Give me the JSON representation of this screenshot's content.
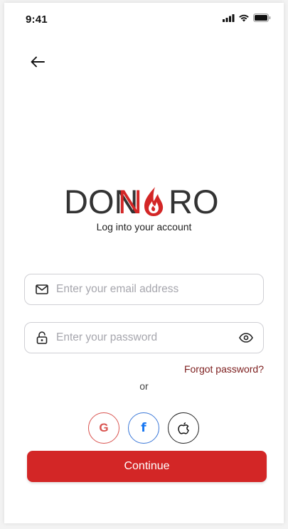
{
  "status_bar": {
    "time": "9:41"
  },
  "back": {
    "icon": "arrow-left-icon"
  },
  "brand": {
    "logo_text_left": "DON",
    "logo_text_red": "N",
    "logo_text_right": "RO",
    "colors": {
      "dark": "#333333",
      "red": "#d32626"
    }
  },
  "login": {
    "subtitle": "Log into your account",
    "email": {
      "value": "",
      "placeholder": "Enter your email address",
      "icon": "mail-icon"
    },
    "password": {
      "value": "",
      "placeholder": "Enter your password",
      "icon": "lock-icon",
      "toggle_icon": "eye-icon"
    },
    "forgot_label": "Forgot password?",
    "or_label": "or",
    "social": {
      "google": {
        "label": "G",
        "color": "#d9534f"
      },
      "facebook": {
        "label": "f",
        "color": "#1877f2"
      },
      "apple": {
        "icon": "apple-icon"
      }
    },
    "continue_label": "Continue",
    "accent_color": "#d32626"
  }
}
